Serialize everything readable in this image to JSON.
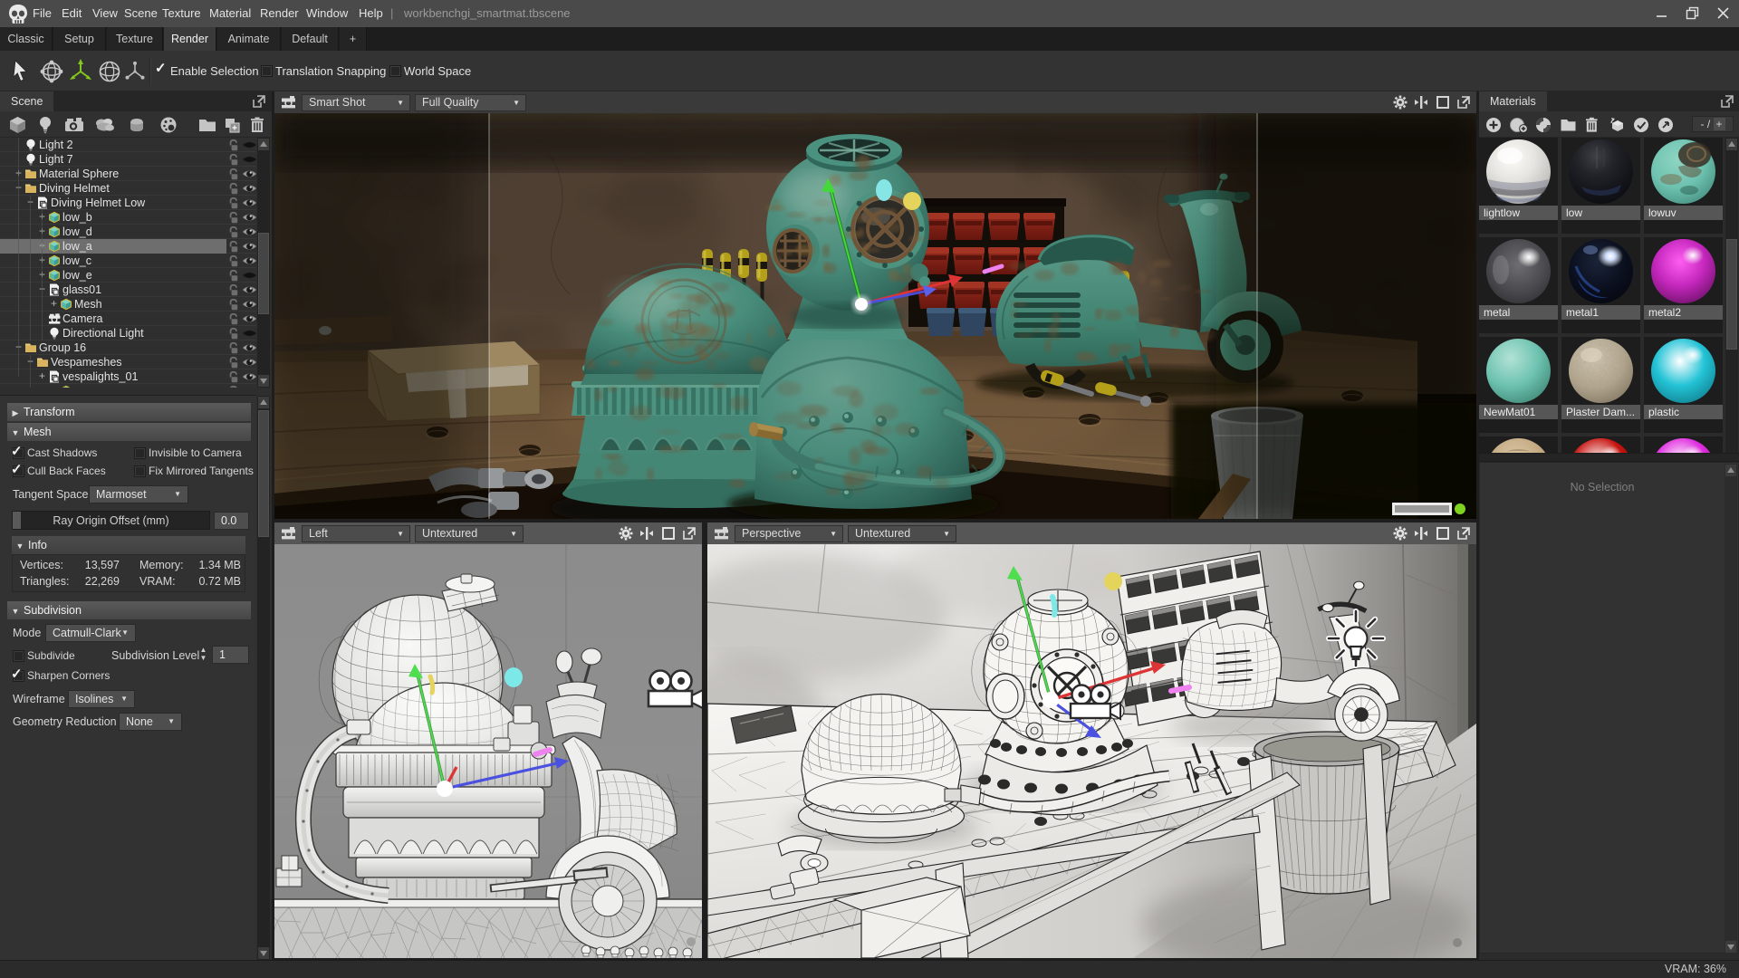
{
  "titlebar": {
    "menus": [
      "File",
      "Edit",
      "View",
      "Scene",
      "Texture",
      "Material",
      "Render",
      "Window",
      "Help"
    ],
    "separator": "|",
    "filename": "workbenchgi_smartmat.tbscene"
  },
  "tabs": [
    {
      "label": "Classic",
      "active": false
    },
    {
      "label": "Setup",
      "active": false
    },
    {
      "label": "Texture",
      "active": false
    },
    {
      "label": "Render",
      "active": true
    },
    {
      "label": "Animate",
      "active": false
    },
    {
      "label": "Default",
      "active": false
    },
    {
      "label": "+",
      "active": false
    }
  ],
  "toolbar": {
    "checkboxes": [
      {
        "label": "Enable Selection",
        "checked": true
      },
      {
        "label": "Translation Snapping",
        "checked": false
      },
      {
        "label": "World Space",
        "checked": false
      }
    ]
  },
  "scene_panel": {
    "title": "Scene",
    "tree": [
      {
        "label": "Light 2",
        "level": 0,
        "expand": "none",
        "icon": "light",
        "eye": "hidden",
        "selected": false
      },
      {
        "label": "Light 7",
        "level": 0,
        "expand": "none",
        "icon": "light",
        "eye": "hidden",
        "selected": false
      },
      {
        "label": "Material Sphere",
        "level": 0,
        "expand": "plus",
        "icon": "folder",
        "eye": "visible",
        "selected": false
      },
      {
        "label": "Diving Helmet",
        "level": 0,
        "expand": "minus",
        "icon": "folder",
        "eye": "visible",
        "selected": false
      },
      {
        "label": "Diving Helmet Low",
        "level": 1,
        "expand": "minus",
        "icon": "model",
        "eye": "visible",
        "selected": false
      },
      {
        "label": "low_b",
        "level": 2,
        "expand": "plus",
        "icon": "mesh",
        "eye": "visible",
        "selected": false
      },
      {
        "label": "low_d",
        "level": 2,
        "expand": "plus",
        "icon": "mesh",
        "eye": "visible",
        "selected": false
      },
      {
        "label": "low_a",
        "level": 2,
        "expand": "plus",
        "icon": "mesh",
        "eye": "visible",
        "selected": true
      },
      {
        "label": "low_c",
        "level": 2,
        "expand": "plus",
        "icon": "mesh",
        "eye": "visible",
        "selected": false
      },
      {
        "label": "low_e",
        "level": 2,
        "expand": "plus",
        "icon": "mesh",
        "eye": "hidden",
        "selected": false
      },
      {
        "label": "glass01",
        "level": 2,
        "expand": "minus",
        "icon": "model",
        "eye": "visible",
        "selected": false
      },
      {
        "label": "Mesh",
        "level": 3,
        "expand": "plus",
        "icon": "mesh",
        "eye": "visible",
        "selected": false
      },
      {
        "label": "Camera",
        "level": 2,
        "expand": "none",
        "icon": "camera",
        "eye": "visible",
        "selected": false
      },
      {
        "label": "Directional Light",
        "level": 2,
        "expand": "none",
        "icon": "light",
        "eye": "hidden",
        "selected": false
      },
      {
        "label": "Group 16",
        "level": 0,
        "expand": "minus",
        "icon": "folder",
        "eye": "visible",
        "selected": false
      },
      {
        "label": "Vespameshes",
        "level": 1,
        "expand": "minus",
        "icon": "folder",
        "eye": "visible",
        "selected": false
      },
      {
        "label": "vespalights_01",
        "level": 2,
        "expand": "plus",
        "icon": "model",
        "eye": "visible",
        "selected": false
      },
      {
        "label": "",
        "level": 3,
        "expand": "plus",
        "icon": "mesh",
        "eye": "visible",
        "selected": false
      }
    ]
  },
  "properties": {
    "transform": {
      "label": "Transform"
    },
    "mesh": {
      "label": "Mesh",
      "cast_shadows": "Cast Shadows",
      "invisible_to_camera": "Invisible to Camera",
      "cull_back_faces": "Cull Back Faces",
      "fix_mirrored_tangents": "Fix Mirrored Tangents",
      "tangent_space_label": "Tangent Space",
      "tangent_space_value": "Marmoset",
      "ray_origin_label": "Ray Origin Offset (mm)",
      "ray_origin_value": "0.0",
      "info": {
        "label": "Info",
        "vertices_label": "Vertices:",
        "vertices_value": "13,597",
        "memory_label": "Memory:",
        "memory_value": "1.34 MB",
        "triangles_label": "Triangles:",
        "triangles_value": "22,269",
        "vram_label": "VRAM:",
        "vram_value": "0.72 MB"
      }
    },
    "subdivision": {
      "label": "Subdivision",
      "mode_label": "Mode",
      "mode_value": "Catmull-Clark",
      "subdivide_label": "Subdivide",
      "level_label": "Subdivision Level",
      "level_value": "1",
      "sharpen_label": "Sharpen Corners",
      "wireframe_label": "Wireframe",
      "wireframe_value": "Isolines",
      "reduction_label": "Geometry Reduction",
      "reduction_value": "None"
    }
  },
  "viewports": {
    "main": {
      "camera": "Smart Shot",
      "quality": "Full Quality"
    },
    "left": {
      "camera": "Left",
      "mode": "Untextured"
    },
    "perspective": {
      "camera": "Perspective",
      "mode": "Untextured"
    }
  },
  "materials": {
    "title": "Materials",
    "counter": {
      "minus": "- /",
      "plus": "+"
    },
    "no_selection": "No Selection",
    "items": [
      {
        "name": "lightlow",
        "kind": "studio"
      },
      {
        "name": "low",
        "kind": "darkglass"
      },
      {
        "name": "lowuv",
        "kind": "verdigris"
      },
      {
        "name": "metal",
        "kind": "metal"
      },
      {
        "name": "metal1",
        "kind": "bluemetal"
      },
      {
        "name": "metal2",
        "kind": "gloss",
        "base": "#c427bc",
        "hi": "#ff5df2",
        "lo": "#4e0a4a"
      },
      {
        "name": "NewMat01",
        "kind": "matte",
        "base": "#6fc3b1",
        "hi": "#b2e2d6",
        "lo": "#39806f"
      },
      {
        "name": "Plaster Dam...",
        "kind": "plaster"
      },
      {
        "name": "plastic",
        "kind": "gloss",
        "base": "#23c3d6",
        "hi": "#ffffff",
        "lo": "#0b6a78"
      },
      {
        "name": "",
        "kind": "wood"
      },
      {
        "name": "",
        "kind": "gloss",
        "base": "#c61410",
        "hi": "#ffffff",
        "lo": "#560604"
      },
      {
        "name": "",
        "kind": "gloss",
        "base": "#df2ddf",
        "hi": "#ffffff",
        "lo": "#6a0c6a"
      }
    ]
  },
  "statusbar": {
    "vram": "VRAM: 36%"
  }
}
